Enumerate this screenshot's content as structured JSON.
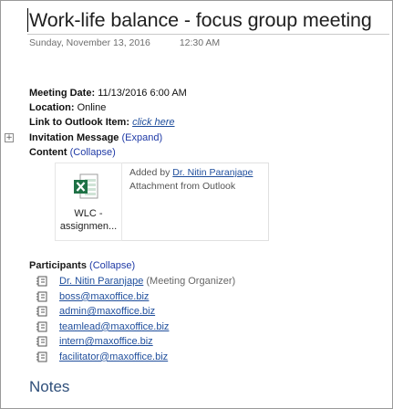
{
  "page": {
    "title": "Work-life balance - focus group meeting",
    "date": "Sunday, November 13, 2016",
    "time": "12:30 AM"
  },
  "meeting": {
    "date_label": "Meeting Date:",
    "date_value": "11/13/2016 6:00 AM",
    "location_label": "Location:",
    "location_value": "Online",
    "link_label": "Link to Outlook Item:",
    "link_value": "click here",
    "invitation_label": "Invitation Message",
    "invitation_action": "(Expand)",
    "content_label": "Content",
    "content_action": "(Collapse)"
  },
  "attachment": {
    "icon": "excel-file-icon",
    "name_line1": "WLC -",
    "name_line2": "assignmen...",
    "added_by_prefix": "Added by",
    "added_by_name": "Dr. Nitin Paranjape",
    "source": "Attachment from Outlook"
  },
  "participants": {
    "label": "Participants",
    "action": "(Collapse)",
    "items": [
      {
        "name": "Dr. Nitin Paranjape",
        "note": "(Meeting Organizer)"
      },
      {
        "name": "boss@maxoffice.biz",
        "note": ""
      },
      {
        "name": "admin@maxoffice.biz",
        "note": ""
      },
      {
        "name": "teamlead@maxoffice.biz",
        "note": ""
      },
      {
        "name": "intern@maxoffice.biz",
        "note": ""
      },
      {
        "name": "facilitator@maxoffice.biz",
        "note": ""
      }
    ]
  },
  "notes": {
    "heading": "Notes"
  },
  "colors": {
    "link": "#1f4e9c",
    "excel_green": "#1e7145",
    "notes_heading": "#2f4f7a"
  }
}
